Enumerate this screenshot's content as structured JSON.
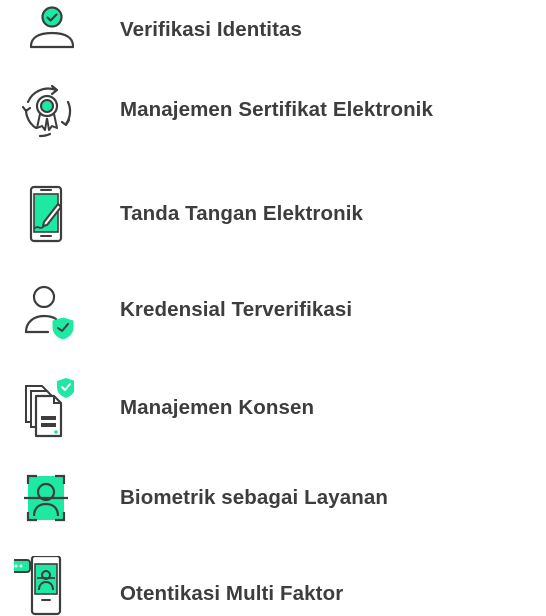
{
  "colors": {
    "accent": "#1de9a2",
    "ink": "#3d3d3d"
  },
  "items": [
    {
      "label": "Verifikasi Identitas",
      "icon": "user-check-icon"
    },
    {
      "label": "Manajemen Sertifikat Elektronik",
      "icon": "certificate-cycle-icon"
    },
    {
      "label": "Tanda Tangan Elektronik",
      "icon": "phone-signature-icon"
    },
    {
      "label": "Kredensial Terverifikasi",
      "icon": "user-shield-icon"
    },
    {
      "label": "Manajemen Konsen",
      "icon": "documents-shield-icon"
    },
    {
      "label": "Biometrik sebagai Layanan",
      "icon": "face-scan-icon"
    },
    {
      "label": "Otentikasi Multi Faktor",
      "icon": "phone-otp-icon"
    }
  ]
}
